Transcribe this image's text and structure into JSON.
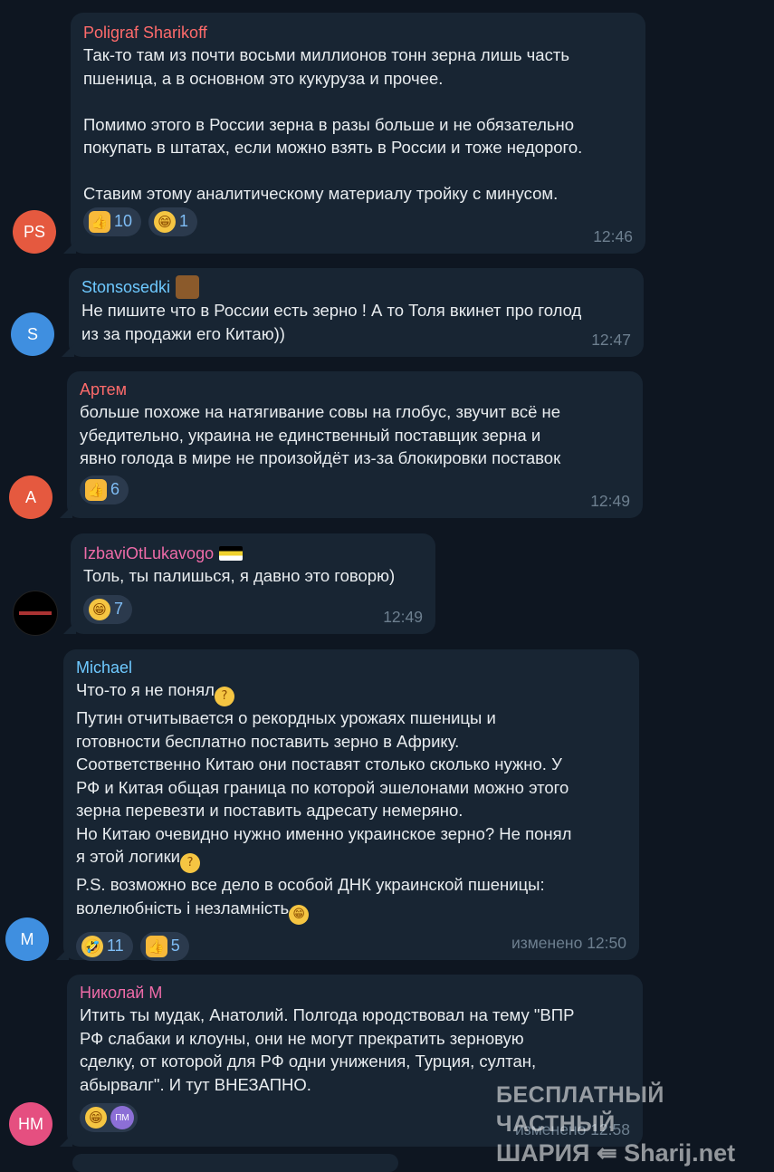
{
  "messages": [
    {
      "sender": "Poligraf Sharikoff",
      "avatar": "PS",
      "text": "Так-то там из почти восьми миллионов тонн зерна лишь часть\nпшеница, а в основном это кукуруза и прочее.\n\nПомимо этого в России зерна в разы больше и не обязательно\nпокупать в штатах, если можно взять в России и тоже недорого.\n\nСтавим этому аналитическому материалу тройку с минусом.",
      "reactions": [
        {
          "icon": "thumbs-up-icon",
          "count": "10"
        },
        {
          "icon": "grin-icon",
          "count": "1"
        }
      ],
      "time": "12:46",
      "colors": {
        "name": "#ff6b6b",
        "avatar": "#e5593f"
      }
    },
    {
      "sender": "Stonsosedki",
      "avatar": "S",
      "text": "Не пишите что в России есть зерно ! А то Толя вкинет про голод\nиз за продажи его Китаю))",
      "time": "12:47",
      "colors": {
        "name": "#6ec9ff",
        "avatar": "#3f8fe0"
      }
    },
    {
      "sender": "Артем",
      "avatar": "А",
      "text": "больше похоже на натягивание совы на глобус, звучит всё не\nубедительно, украина не единственный поставщик зерна и\nявно голода в мире не произойдёт из-за блокировки поставок",
      "reactions": [
        {
          "icon": "thumbs-up-icon",
          "count": "6"
        }
      ],
      "time": "12:49",
      "colors": {
        "name": "#ff6b6b",
        "avatar": "#e5593f"
      }
    },
    {
      "sender": "IzbaviOtLukavogo",
      "text": "Толь, ты палишься, я давно это говорю)",
      "reactions": [
        {
          "icon": "grin-icon",
          "count": "7"
        }
      ],
      "time": "12:49",
      "colors": {
        "name": "#ee6ba8",
        "avatar": "#000000"
      }
    },
    {
      "sender": "Michael",
      "avatar": "M",
      "text_parts": [
        "Что-то я не понял",
        "\nПутин отчитывается о рекордных урожаях пшеницы и\nготовности бесплатно поставить зерно в Африку.\nСоответственно Китаю они поставят столько сколько нужно. У\nРФ и Китая общая граница по которой эшелонами можно этого\nзерна перевезти и поставить адресату немеряно.\nНо Китаю очевидно нужно именно украинское зерно? Не понял\nя этой логики",
        "\nP.S. возможно все дело в особой ДНК украинской пшеницы:\nволелюбність і незламність"
      ],
      "reactions": [
        {
          "icon": "rofl-icon",
          "count": "11"
        },
        {
          "icon": "thumbs-up-icon",
          "count": "5"
        }
      ],
      "edited": "изменено",
      "time": "12:50",
      "colors": {
        "name": "#6ec9ff",
        "avatar": "#3f8fe0"
      }
    },
    {
      "sender": "Николай М",
      "avatar": "НМ",
      "text": "Итить ты мудак, Анатолий. Полгода юродствовал на тему \"ВПР\nРФ слабаки и клоуны, они не могут прекратить зерновую\nсделку, от которой для РФ одни унижения, Турция, султан,\nабырвалг\". И тут ВНЕЗАПНО.",
      "reactions_pm": "ПМ",
      "edited": "изменено",
      "time": "12:58",
      "colors": {
        "name": "#ee6ba8",
        "avatar": "#e54f80"
      }
    }
  ],
  "watermark": {
    "line1": "БЕСПЛАТНЫЙ ЧАСТНЫЙ",
    "line2": "ШАРИЯ ⇚ Sharij.net"
  }
}
